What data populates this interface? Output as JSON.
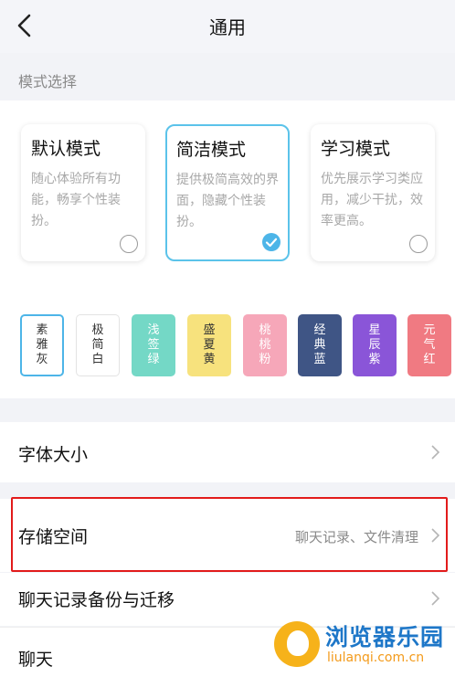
{
  "header": {
    "title": "通用"
  },
  "mode_section": {
    "label": "模式选择",
    "modes": [
      {
        "title": "默认模式",
        "desc": "随心体验所有功能，畅享个性装扮。",
        "selected": false
      },
      {
        "title": "简洁模式",
        "desc": "提供极简高效的界面，隐藏个性装扮。",
        "selected": true
      },
      {
        "title": "学习模式",
        "desc": "优先展示学习类应用，减少干扰，效率更高。",
        "selected": false
      }
    ]
  },
  "themes": [
    {
      "name": "素雅灰",
      "bg": "#ffffff",
      "color": "#333333",
      "selected": true
    },
    {
      "name": "极简白",
      "bg": "#ffffff",
      "color": "#333333",
      "selected": false
    },
    {
      "name": "浅签绿",
      "bg": "#74d8c6",
      "color": "#ffffff",
      "selected": false
    },
    {
      "name": "盛夏黄",
      "bg": "#f7e27d",
      "color": "#333333",
      "selected": false
    },
    {
      "name": "桃桃粉",
      "bg": "#f6a7b9",
      "color": "#ffffff",
      "selected": false
    },
    {
      "name": "经典蓝",
      "bg": "#3f5585",
      "color": "#ffffff",
      "selected": false
    },
    {
      "name": "星辰紫",
      "bg": "#8a55d8",
      "color": "#ffffff",
      "selected": false
    },
    {
      "name": "元气红",
      "bg": "#f07a82",
      "color": "#ffffff",
      "selected": false
    }
  ],
  "settings": [
    {
      "label": "字体大小",
      "value": ""
    },
    {
      "label": "存储空间",
      "value": "聊天记录、文件清理"
    },
    {
      "label": "聊天记录备份与迁移",
      "value": ""
    },
    {
      "label": "聊天",
      "value": ""
    }
  ],
  "watermark": {
    "name": "浏览器乐园",
    "url": "liulanqi.com.cn"
  },
  "colors": {
    "accent": "#4db5e8",
    "highlight": "#e21b1b"
  }
}
